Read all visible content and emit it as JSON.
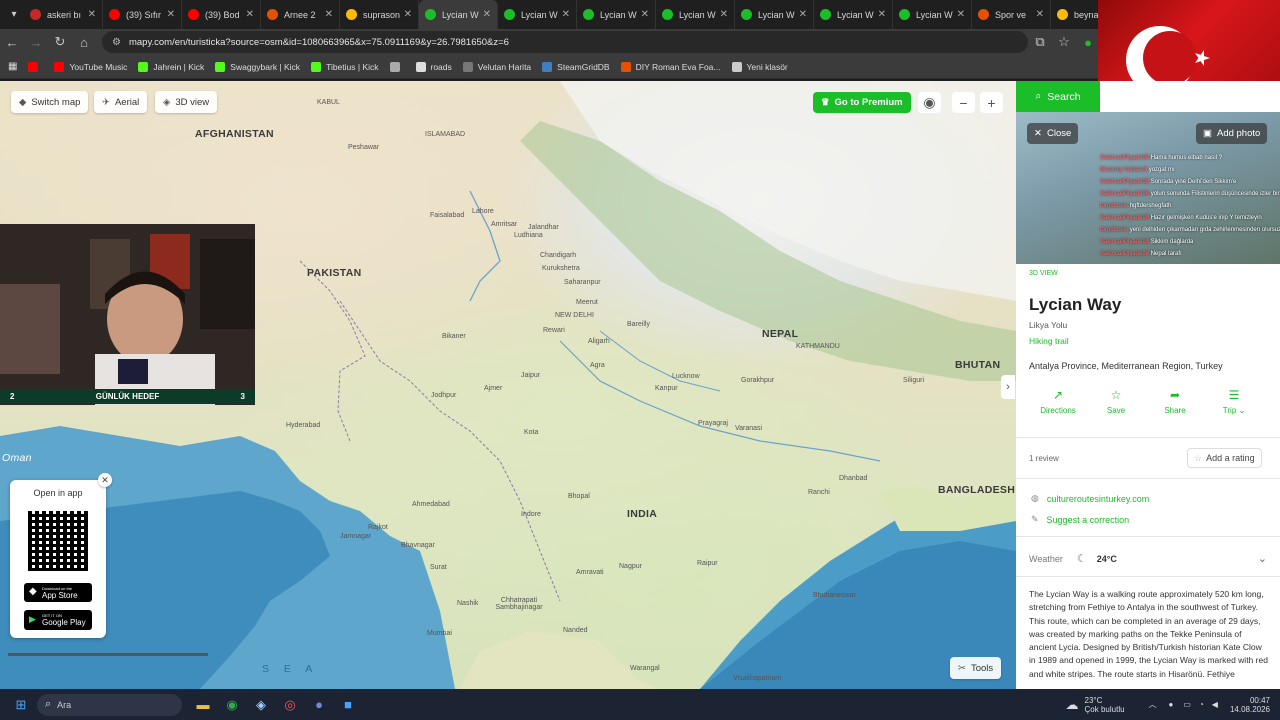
{
  "tabs": [
    {
      "label": "askeri bı",
      "icon_color": "#c62828"
    },
    {
      "label": "(39) Sıfır",
      "icon_color": "#ff0000"
    },
    {
      "label": "(39) Bod",
      "icon_color": "#ff0000"
    },
    {
      "label": "Arnee 2",
      "icon_color": "#e65100"
    },
    {
      "label": "suprason",
      "icon_color": "#fbbc04"
    },
    {
      "label": "Lycian W",
      "icon_color": "#1bbd28"
    },
    {
      "label": "Lycian W",
      "icon_color": "#1bbd28"
    },
    {
      "label": "Lycian W",
      "icon_color": "#1bbd28"
    },
    {
      "label": "Lycian W",
      "icon_color": "#1bbd28"
    },
    {
      "label": "Lycian W",
      "icon_color": "#1bbd28"
    },
    {
      "label": "Lycian W",
      "icon_color": "#1bbd28"
    },
    {
      "label": "Lycian W",
      "icon_color": "#1bbd28"
    },
    {
      "label": "Spor ve",
      "icon_color": "#e65100"
    },
    {
      "label": "beyna",
      "icon_color": "#fbbc04"
    }
  ],
  "address": {
    "url": "mapy.com/en/turisticka?source=osm&id=1080663965&x=75.0911169&y=26.7981650&z=6"
  },
  "bookmarks": [
    {
      "label": "YouTube Music",
      "color": "#ff0000"
    },
    {
      "label": "Jahrein | Kick",
      "color": "#53fc18"
    },
    {
      "label": "Swaggybark | Kick",
      "color": "#53fc18"
    },
    {
      "label": "Tibetius | Kick",
      "color": "#53fc18"
    },
    {
      "label": "",
      "color": "#aaaaaa"
    },
    {
      "label": "roads",
      "color": "#dddddd"
    },
    {
      "label": "Velutan Harita",
      "color": "#777777"
    },
    {
      "label": "SteamGridDB",
      "color": "#3f7fbf"
    },
    {
      "label": "DIY Roman Eva Foa...",
      "color": "#e65100"
    },
    {
      "label": "Yeni klasör",
      "color": "#cccccc"
    }
  ],
  "map": {
    "switch_map": "Switch map",
    "aerial": "Aerial",
    "view3d": "3D view",
    "premium": "Go to Premium",
    "countries": {
      "afghanistan": "AFGHANISTAN",
      "pakistan": "PAKISTAN",
      "india": "INDIA",
      "nepal": "NEPAL",
      "bhutan": "BHUTAN",
      "bangladesh": "BANGLADESH",
      "oman": "Oman"
    },
    "cities": {
      "kabul": "KABUL",
      "islamabad": "ISLAMABAD",
      "peshawar": "Peshawar",
      "faisalabad": "Faisalabad",
      "lahore": "Lahore",
      "amritsar": "Amritsar",
      "jalandhar": "Jalandhar",
      "ludhiana": "Ludhiana",
      "chandigarh": "Chandigarh",
      "kurukshetra": "Kurukshetra",
      "saharanpur": "Saharanpur",
      "meerut": "Meerut",
      "new_delhi": "NEW DELHI",
      "bareilly": "Bareilly",
      "rewari": "Rewari",
      "aligarh": "Aligarh",
      "agra": "Agra",
      "kathmandu": "KATHMANDU",
      "siliguri": "Siliguri",
      "bikaner": "Bikaner",
      "jaipur": "Jaipur",
      "lucknow": "Lucknow",
      "gorakhpur": "Gorakhpur",
      "kanpur": "Kanpur",
      "jodhpur": "Jodhpur",
      "ajmer": "Ajmer",
      "prayagraj": "Prayagraj",
      "varanasi": "Varanasi",
      "hyderabad_pk": "Hyderabad",
      "kota": "Kota",
      "dhanbad": "Dhanbad",
      "ranchi": "Ranchi",
      "ahmedabad": "Ahmedabad",
      "bhopal": "Bhopal",
      "indore": "Indore",
      "rajkot": "Rajkot",
      "jamnagar": "Jamnagar",
      "bhavnagar": "Bhavnagar",
      "surat": "Surat",
      "nagpur": "Nagpur",
      "raipur": "Raipur",
      "amravati": "Amravati",
      "bhubaneswar": "Bhubaneswar",
      "nashik": "Nashik",
      "chhatrapati": "Chhatrapati Sambhajinagar",
      "mumbai": "Mumbai",
      "nanded": "Nanded",
      "warangal": "Warangal",
      "visakhapatnam": "Visakhapatnam"
    },
    "sea_label": "S E A",
    "app_card": {
      "title": "Open in app",
      "app_store_small": "Download on the",
      "app_store": "App Store",
      "google_small": "GET IT ON",
      "google": "Google Play"
    },
    "tools": "Tools"
  },
  "stream": {
    "goal_left": "2",
    "goal_label": "GÜNLÜK HEDEF",
    "goal_right": "3"
  },
  "panel": {
    "search": "Search",
    "close": "Close",
    "add_photo": "Add photo",
    "view3d": "3D VIEW",
    "title": "Lycian Way",
    "subtitle": "Likya Yolu",
    "category": "Hiking trail",
    "location": "Antalya Province, Mediterranean Region, Turkey",
    "actions": [
      {
        "label": "Directions"
      },
      {
        "label": "Save"
      },
      {
        "label": "Share"
      },
      {
        "label": "Trip"
      }
    ],
    "reviews": "1 review",
    "add_rating": "Add a rating",
    "website": "cultureroutesinturkey.com",
    "suggest": "Suggest a correction",
    "weather_label": "Weather",
    "weather_temp": "24°C",
    "description": "The Lycian Way is a walking route approximately 520 km long, stretching from Fethiye to Antalya in the southwest of Turkey. This route, which can be completed in an average of 29 days, was created by marking paths on the Tekke Peninsula of ancient Lycia. Designed by British/Turkish historian Kate Clow in 1989 and opened in 1999, the Lycian Way is marked with red and white stripes. The route starts in Hisarönü. Fethiye"
  },
  "chat": [
    {
      "user": "SakincaliPiyade98",
      "msg": "Hama humus elbab nasıl ?"
    },
    {
      "user": "lilisevmy hebiandi",
      "msg": "yozgat mı"
    },
    {
      "user": "SakincaliPiyade98",
      "msg": "Sonrada yine Delhi'den Sikkim'e"
    },
    {
      "user": "SakincaliPiyade98",
      "msg": "yolun sonunda Filistinlerin düşüncesinde izler birbirinizi"
    },
    {
      "user": "torpidoreis",
      "msg": "hgftdershegfath"
    },
    {
      "user": "SakincaliPiyade98",
      "msg": "Hazır gelmişken Kudüs'e inip Y temizleyin"
    },
    {
      "user": "torpidoreis",
      "msg": "yeni delhiden çıkarmadan gıda zehirlenmesinden olursuz"
    },
    {
      "user": "SakincaliPiyade98",
      "msg": "Sikkim dağlarda"
    },
    {
      "user": "SakincaliPiyade98",
      "msg": "Nepal tarafı"
    }
  ],
  "taskbar": {
    "search": "Ara",
    "weather_temp": "23°C",
    "weather_desc": "Çok bulutlu",
    "time": "00:47",
    "date": "14.08.2026"
  },
  "colors": {
    "accent": "#1bbd28"
  }
}
